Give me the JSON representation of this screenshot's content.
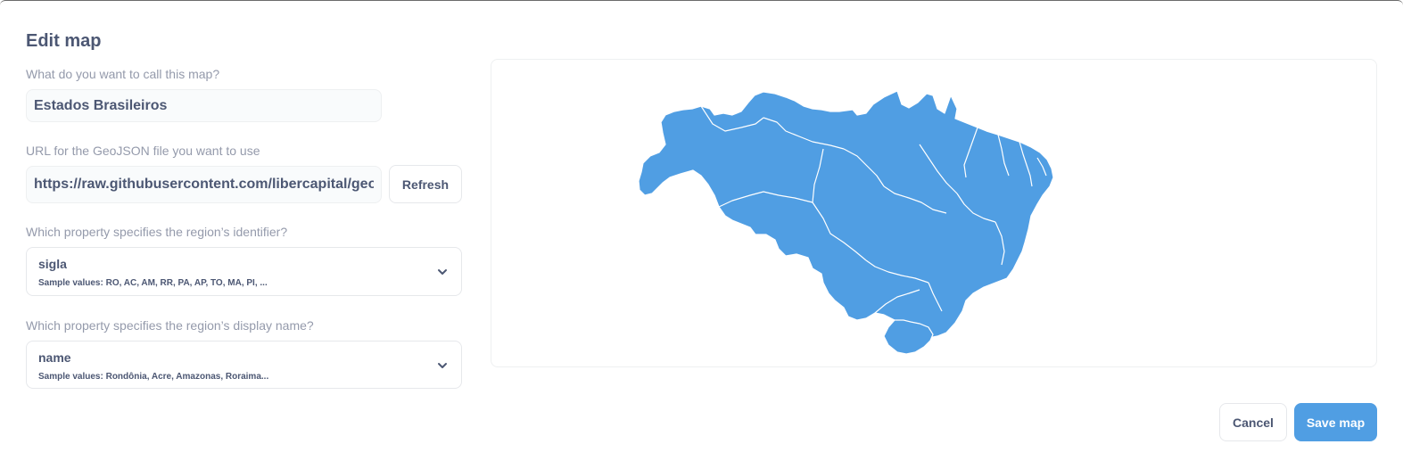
{
  "dialog": {
    "title": "Edit map"
  },
  "form": {
    "name_label": "What do you want to call this map?",
    "name_value": "Estados Brasileiros",
    "url_label": "URL for the GeoJSON file you want to use",
    "url_value": "https://raw.githubusercontent.com/libercapital/geojs",
    "refresh_label": "Refresh",
    "identifier_label": "Which property specifies the region’s identifier?",
    "identifier_value": "sigla",
    "identifier_samples": "Sample values: RO, AC, AM, RR, PA, AP, TO, MA, PI, ...",
    "display_label": "Which property specifies the region’s display name?",
    "display_value": "name",
    "display_samples": "Sample values: Rondônia, Acre, Amazonas, Roraima..."
  },
  "preview": {
    "map_fill": "#509ee3",
    "map_border": "#ffffff",
    "icon": "map-preview"
  },
  "footer": {
    "cancel_label": "Cancel",
    "save_label": "Save map"
  },
  "colors": {
    "accent": "#509ee3",
    "text": "#4c5773",
    "muted": "#949aab"
  }
}
